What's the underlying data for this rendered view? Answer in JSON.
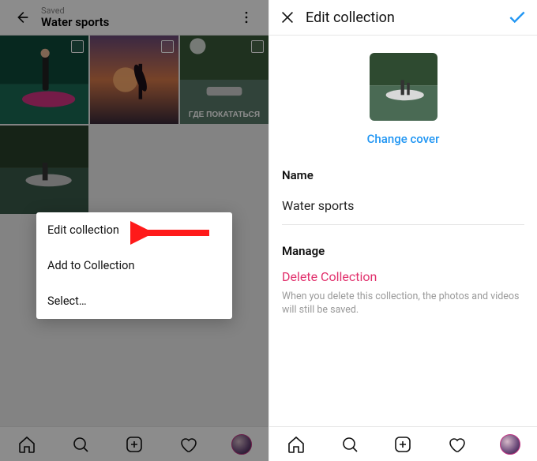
{
  "left": {
    "saved_label": "Saved",
    "collection_name": "Water sports",
    "menu": {
      "edit": "Edit collection",
      "add": "Add to Collection",
      "select": "Select…"
    }
  },
  "right": {
    "title": "Edit collection",
    "change_cover": "Change cover",
    "name_label": "Name",
    "name_value": "Water sports",
    "manage_label": "Manage",
    "delete_label": "Delete Collection",
    "delete_hint": "When you delete this collection, the photos and videos will still be saved."
  },
  "thumb_overlay_text": "ГДЕ ПОКАТАТЬСЯ",
  "colors": {
    "accent": "#2196f3",
    "danger": "#e1306c"
  }
}
